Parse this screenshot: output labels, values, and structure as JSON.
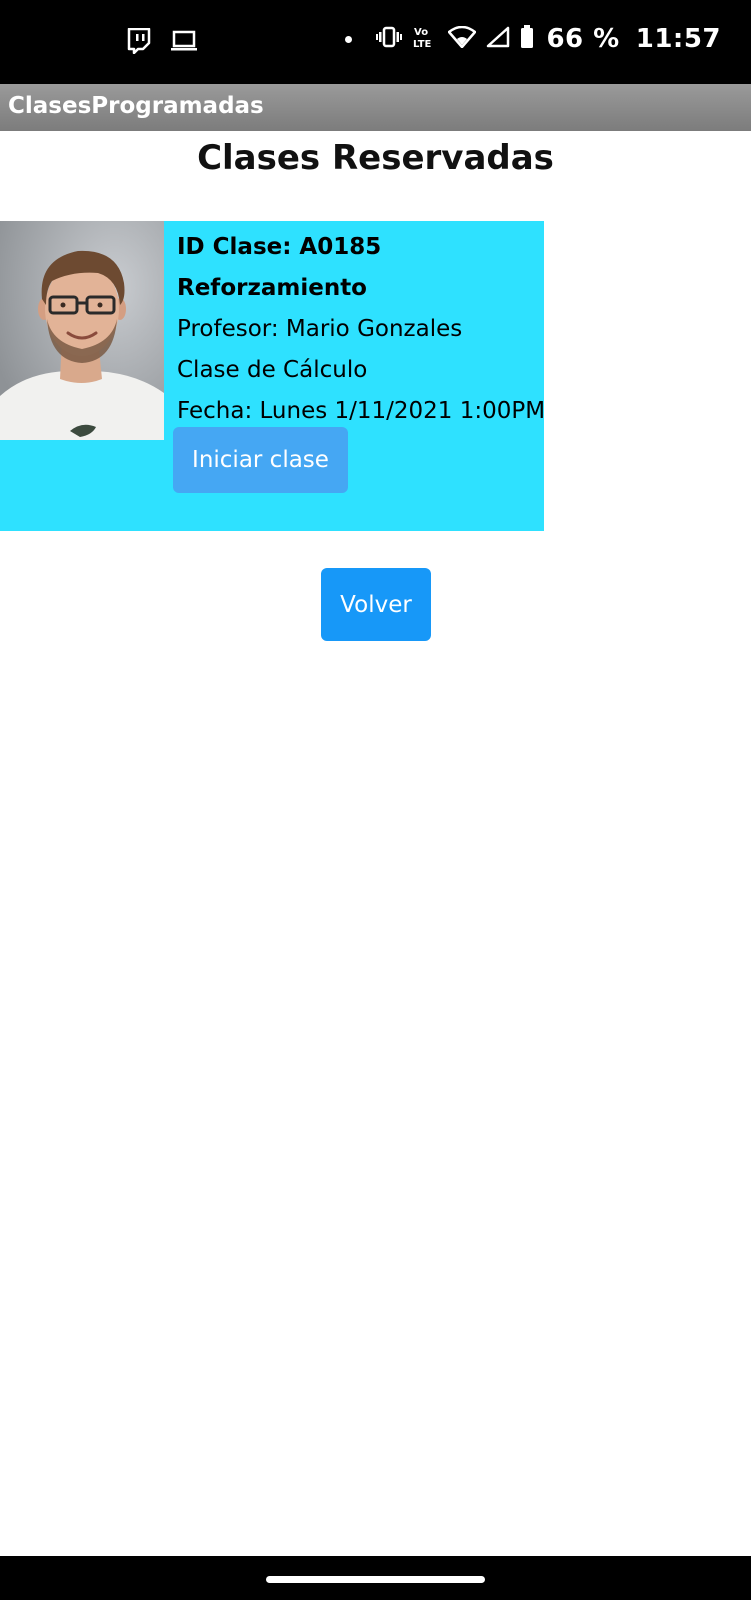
{
  "status_bar": {
    "left_icons": [
      "twitch-icon",
      "laptop-icon"
    ],
    "right_icons": [
      "notification-dot-icon",
      "vibrate-icon",
      "volte-icon",
      "wifi-icon",
      "signal-icon",
      "battery-icon"
    ],
    "volte_text": "Vo LTE",
    "battery_percent": "66 %",
    "time": "11:57"
  },
  "action_bar": {
    "title": "ClasesProgramadas"
  },
  "page": {
    "title": "Clases Reservadas"
  },
  "class_card": {
    "photo_icon": "teacher-photo",
    "id_line": "ID Clase: A0185",
    "type": "Reforzamiento",
    "teacher": "Profesor: Mario Gonzales",
    "subject": "Clase de Cálculo",
    "date": "Fecha: Lunes 1/11/2021 1:00PM",
    "start_button_label": "Iniciar clase"
  },
  "back_button_label": "Volver",
  "colors": {
    "card_background": "#2ee1ff",
    "start_button": "#45a7f3",
    "back_button": "#1798f8",
    "action_bar": "#8a8a8a"
  }
}
